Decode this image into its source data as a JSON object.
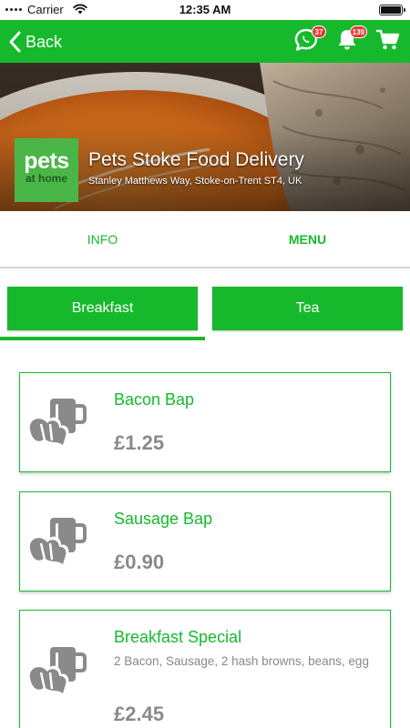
{
  "status_bar": {
    "carrier": "Carrier",
    "time": "12:35 AM"
  },
  "header": {
    "back_label": "Back",
    "chat_badge": "37",
    "notification_badge": "139",
    "accent_color": "#16b92c"
  },
  "store": {
    "logo_line1": "pets",
    "logo_line2": "at home",
    "name": "Pets Stoke Food Delivery",
    "address": "Stanley Matthews Way, Stoke-on-Trent ST4, UK"
  },
  "main_tabs": [
    {
      "label": "INFO",
      "active": false
    },
    {
      "label": "MENU",
      "active": true
    }
  ],
  "category_tabs": [
    {
      "label": "Breakfast",
      "active": true
    },
    {
      "label": "Tea",
      "active": false
    }
  ],
  "menu_items": [
    {
      "name": "Bacon Bap",
      "description": "",
      "price": "£1.25",
      "icon": "breakfast-icon"
    },
    {
      "name": "Sausage Bap",
      "description": "",
      "price": "£0.90",
      "icon": "breakfast-icon"
    },
    {
      "name": "Breakfast Special",
      "description": "2 Bacon, Sausage, 2 hash browns, beans, egg",
      "price": "£2.45",
      "icon": "breakfast-icon"
    }
  ]
}
